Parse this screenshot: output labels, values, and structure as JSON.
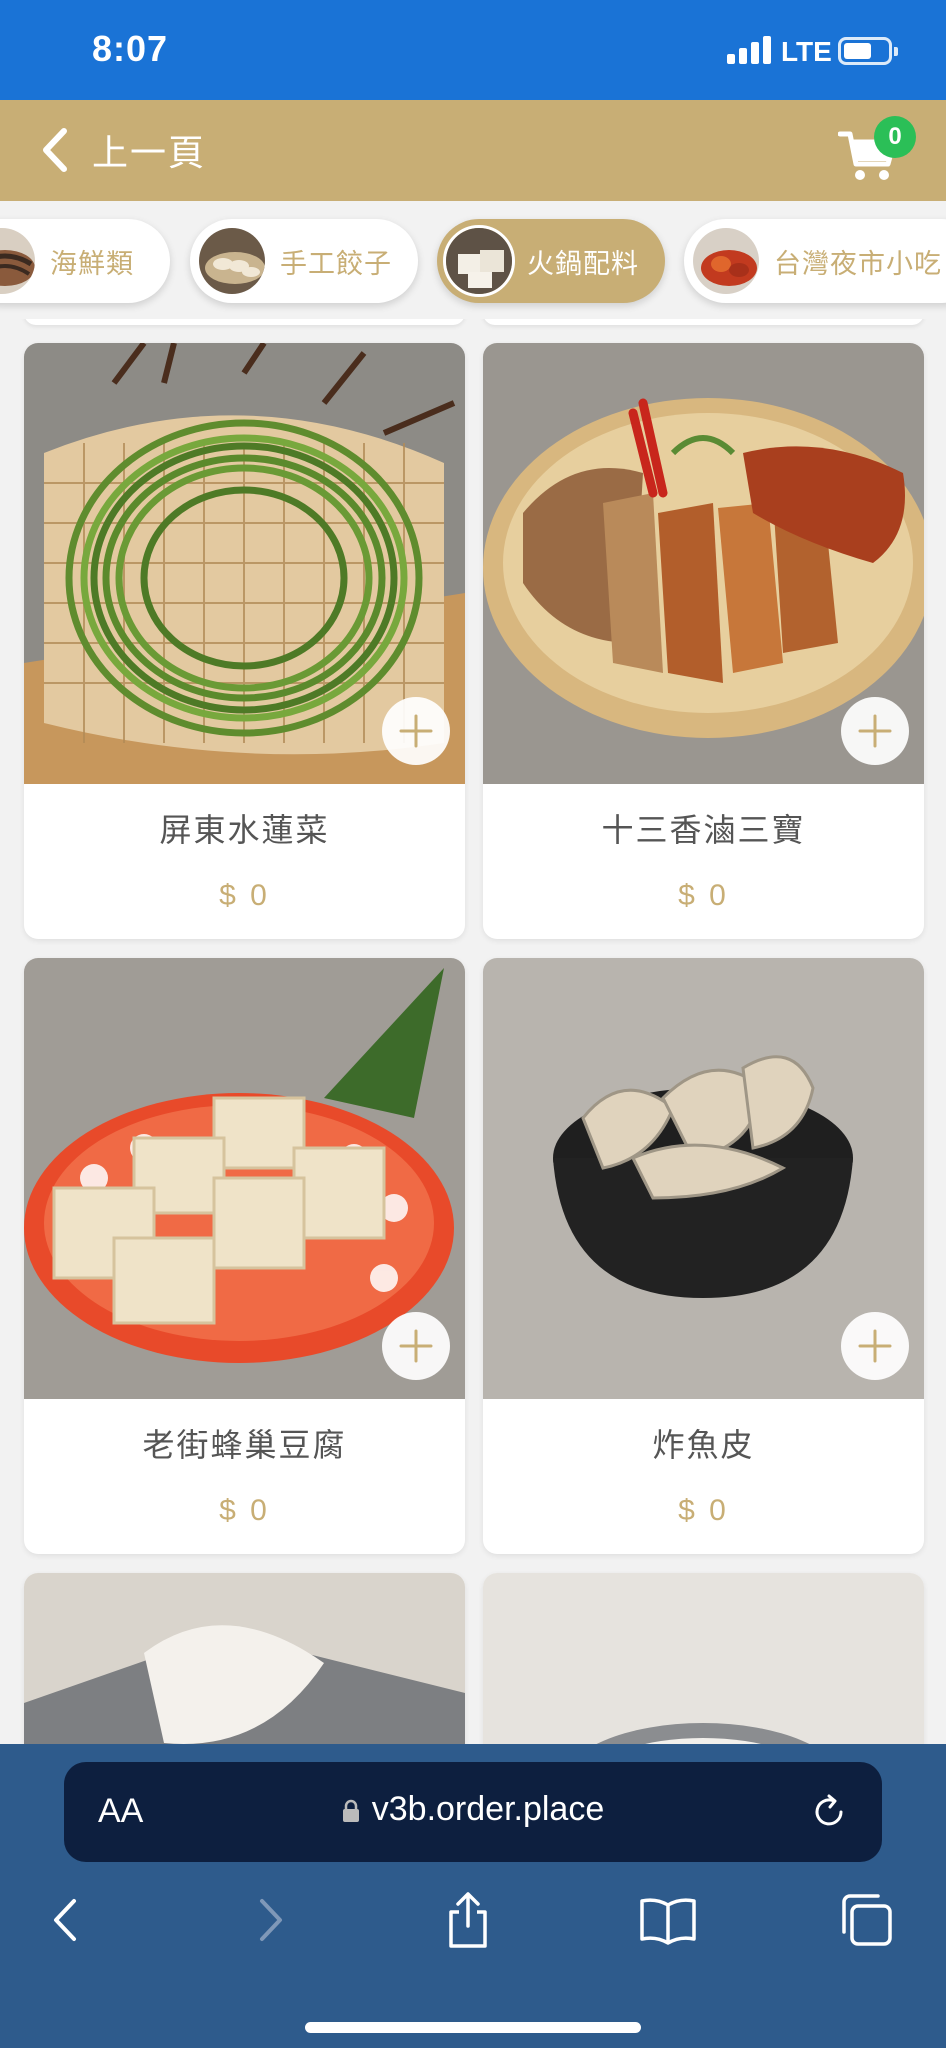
{
  "status_bar": {
    "time": "8:07",
    "network": "LTE",
    "battery_level": 0.65
  },
  "header": {
    "back_label": "上一頁",
    "cart_count": "0"
  },
  "categories": [
    {
      "label": "海鮮類",
      "active": false
    },
    {
      "label": "手工餃子",
      "active": false
    },
    {
      "label": "火鍋配料",
      "active": true
    },
    {
      "label": "台灣夜市小吃",
      "active": false
    }
  ],
  "products": [
    {
      "name": "屏東水蓮菜",
      "price": "$ 0"
    },
    {
      "name": "十三香滷三寶",
      "price": "$ 0"
    },
    {
      "name": "老街蜂巢豆腐",
      "price": "$ 0"
    },
    {
      "name": "炸魚皮",
      "price": "$ 0"
    }
  ],
  "browser": {
    "text_size_label": "AA",
    "url": "v3b.order.place"
  },
  "colors": {
    "gold": "#c8ae75",
    "status_blue": "#1a73d6",
    "badge_green": "#2bbf57",
    "browser_bar": "#2e5b8c"
  }
}
